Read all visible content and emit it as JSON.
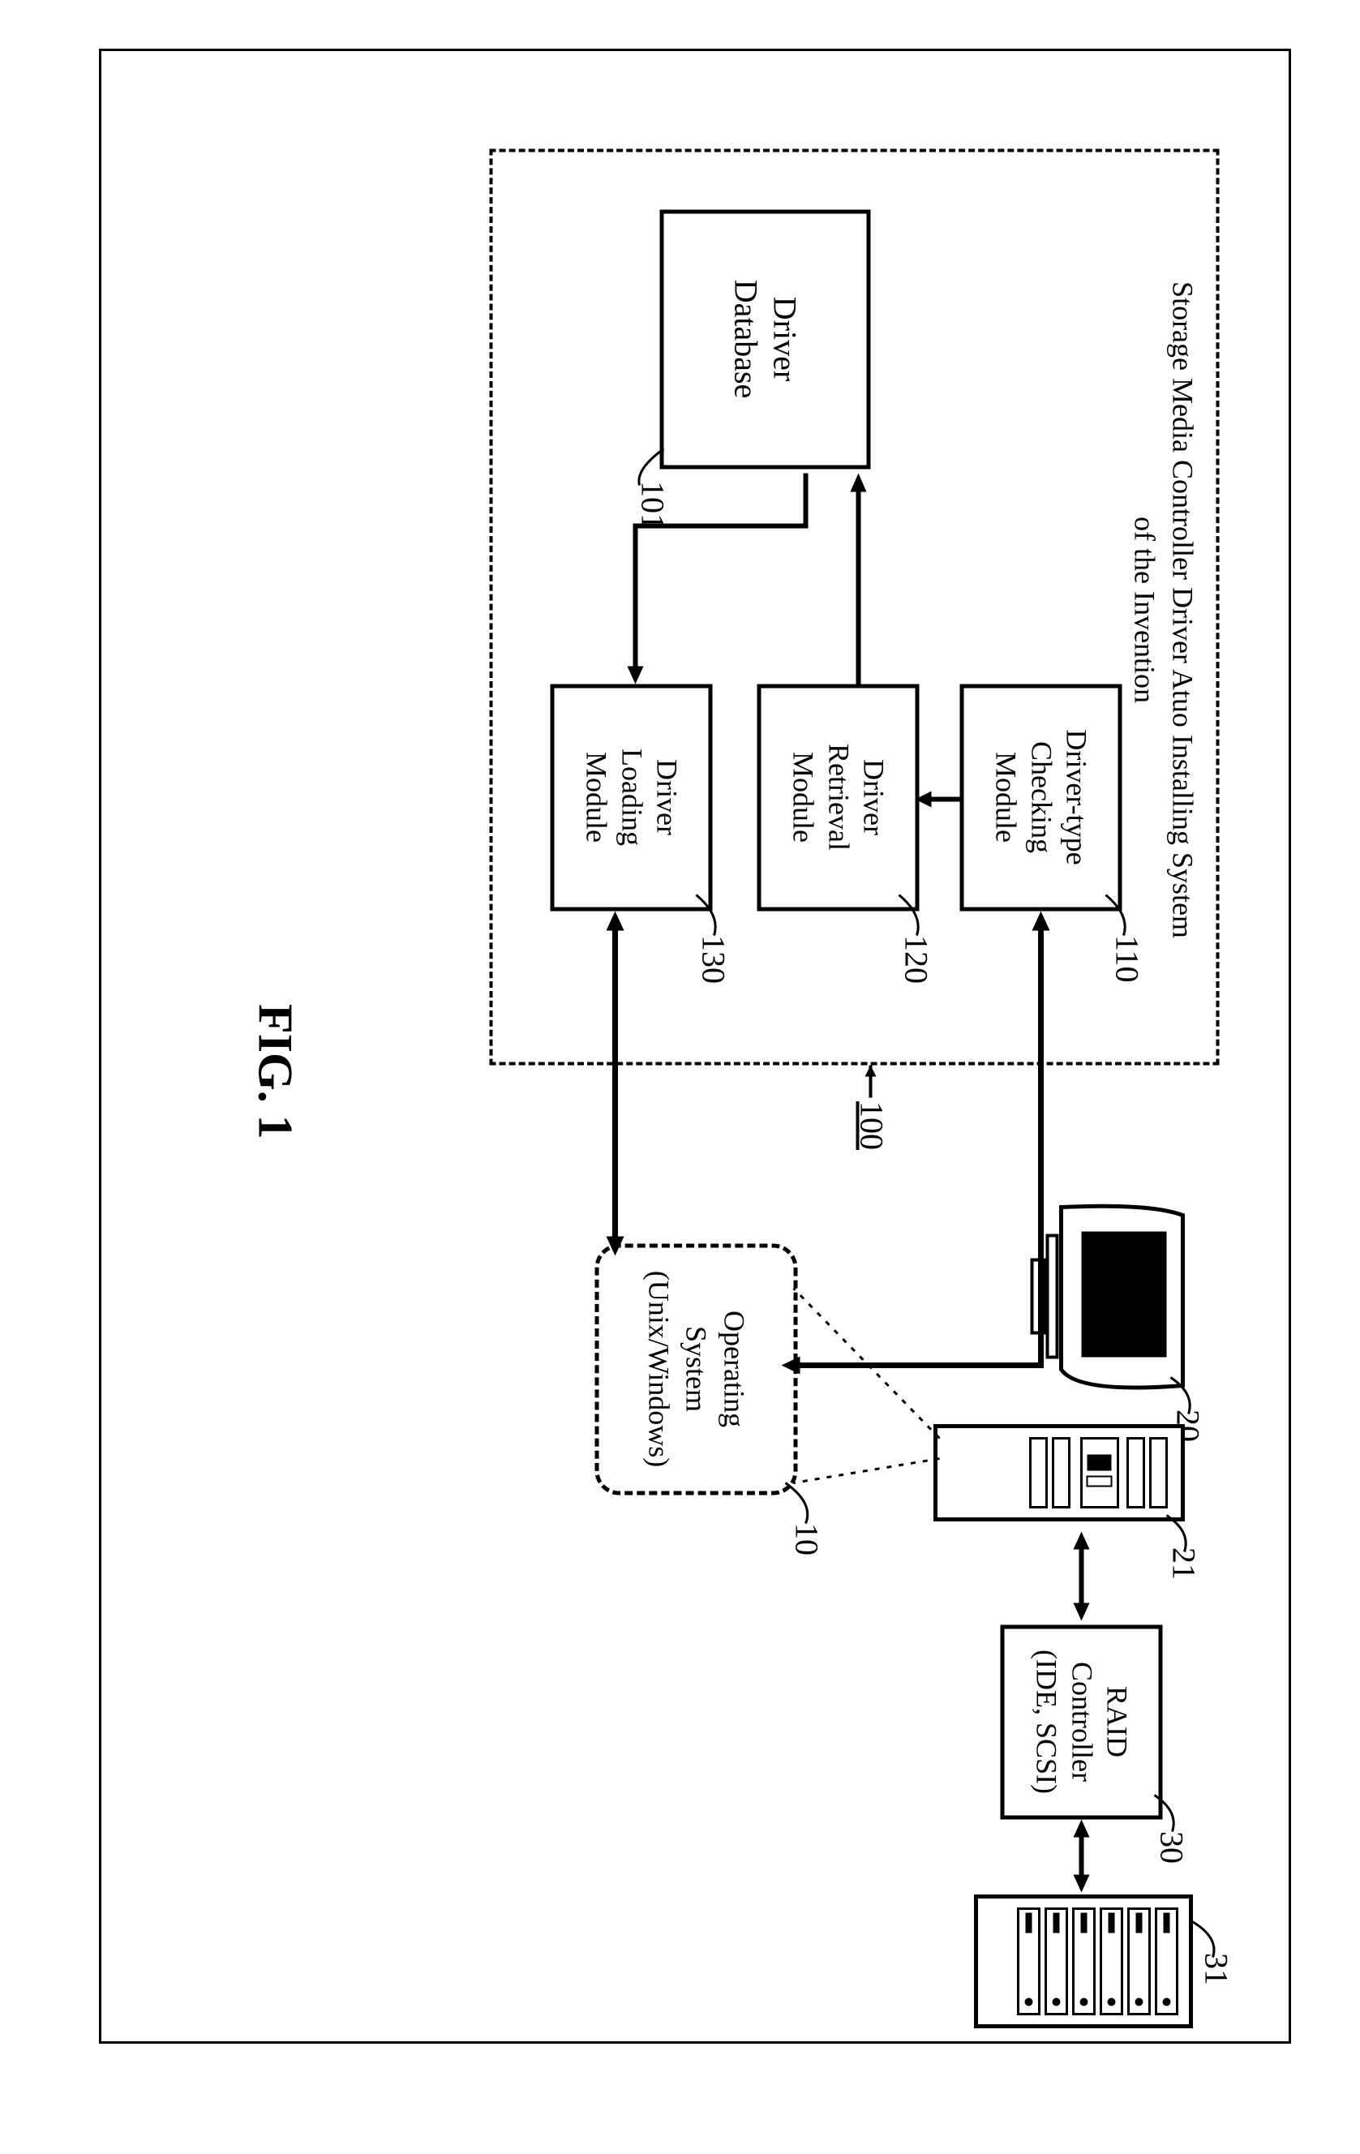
{
  "figure_label": "FIG. 1",
  "system_container": {
    "title_line1": "Storage Media Controller Driver Atuo Installing System",
    "title_line2": "of the Invention",
    "ref": "100"
  },
  "boxes": {
    "driver_database": {
      "line1": "Driver",
      "line2": "Database",
      "ref": "101"
    },
    "checking_module": {
      "line1": "Driver-type",
      "line2": "Checking",
      "line3": "Module",
      "ref": "110"
    },
    "retrieval_module": {
      "line1": "Driver",
      "line2": "Retrieval",
      "line3": "Module",
      "ref": "120"
    },
    "loading_module": {
      "line1": "Driver",
      "line2": "Loading",
      "line3": "Module",
      "ref": "130"
    },
    "operating_system": {
      "line1": "Operating",
      "line2": "System",
      "line3": "(Unix/Windows)",
      "ref": "10"
    },
    "raid_controller": {
      "line1": "RAID",
      "line2": "Controller",
      "line3": "(IDE, SCSI)",
      "ref": "30"
    }
  },
  "hardware": {
    "monitor_ref": "20",
    "server_ref": "21",
    "disk_ref": "31"
  }
}
